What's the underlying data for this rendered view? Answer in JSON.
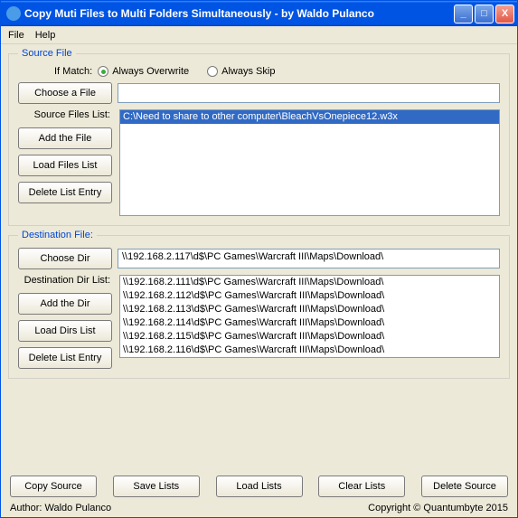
{
  "window": {
    "title": "Copy Muti Files to Multi Folders Simultaneously - by Waldo Pulanco"
  },
  "menu": {
    "file": "File",
    "help": "Help"
  },
  "source": {
    "legend": "Source File",
    "if_match_label": "If Match:",
    "radio_overwrite": "Always Overwrite",
    "radio_skip": "Always Skip",
    "choose_file_btn": "Choose a File",
    "file_input": "",
    "list_label": "Source Files List:",
    "add_btn": "Add the File",
    "load_btn": "Load Files List",
    "delete_btn": "Delete List Entry",
    "items": [
      "C:\\Need to share to other computer\\BleachVsOnepiece12.w3x"
    ]
  },
  "dest": {
    "legend": "Destination File:",
    "choose_dir_btn": "Choose Dir",
    "dir_input": "\\\\192.168.2.117\\d$\\PC Games\\Warcraft III\\Maps\\Download\\",
    "list_label": "Destination Dir List:",
    "add_btn": "Add the Dir",
    "load_btn": "Load Dirs List",
    "delete_btn": "Delete List Entry",
    "items": [
      "\\\\192.168.2.111\\d$\\PC Games\\Warcraft III\\Maps\\Download\\",
      "\\\\192.168.2.112\\d$\\PC Games\\Warcraft III\\Maps\\Download\\",
      "\\\\192.168.2.113\\d$\\PC Games\\Warcraft III\\Maps\\Download\\",
      "\\\\192.168.2.114\\d$\\PC Games\\Warcraft III\\Maps\\Download\\",
      "\\\\192.168.2.115\\d$\\PC Games\\Warcraft III\\Maps\\Download\\",
      "\\\\192.168.2.116\\d$\\PC Games\\Warcraft III\\Maps\\Download\\"
    ]
  },
  "bottom": {
    "copy": "Copy Source",
    "save": "Save Lists",
    "load": "Load Lists",
    "clear": "Clear Lists",
    "delete": "Delete Source"
  },
  "footer": {
    "author": "Author: Waldo Pulanco",
    "copyright": "Copyright © Quantumbyte 2015"
  }
}
